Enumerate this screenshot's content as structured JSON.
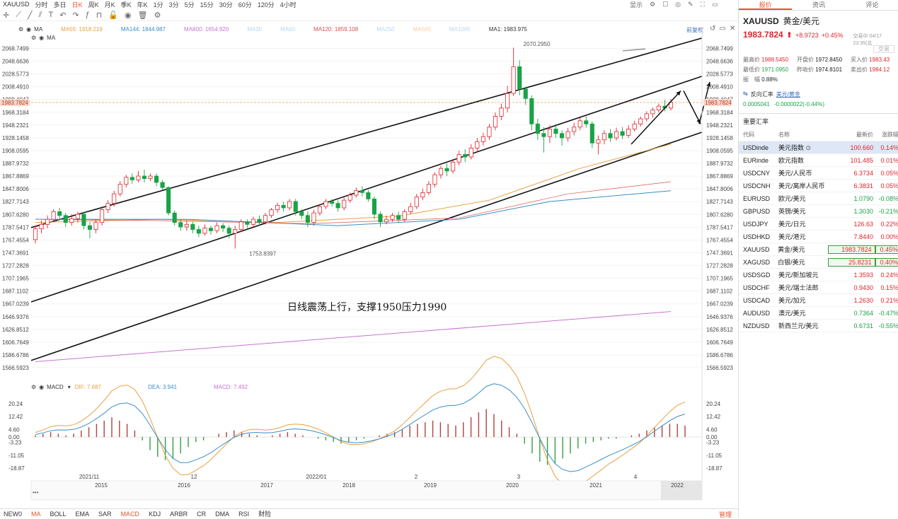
{
  "toolbar": {
    "symbol": "XAUUSD",
    "periods": [
      "分时",
      "多日",
      "日K",
      "周K",
      "月K",
      "季K",
      "年K",
      "1分",
      "3分",
      "5分",
      "15分",
      "30分",
      "60分",
      "120分",
      "4小时"
    ],
    "active_period": "日K",
    "display_label": "显示",
    "icons": [
      "crosshair-icon",
      "draw-icon",
      "line-icon",
      "text-icon",
      "indicator-icon",
      "undo-icon",
      "redo-icon",
      "fx-icon",
      "magnet-icon",
      "lock-icon",
      "eye-icon",
      "delete-icon",
      "settings-icon"
    ]
  },
  "legend": {
    "row1_name": "MA",
    "ma55": "MA55: 1918.219",
    "ma144": "MA144: 1844.987",
    "ma800": "MA800: 1654.920",
    "ma30": "MA30",
    "ma60": "MA60",
    "ma120": "MA120: 1859.108",
    "ma250": "MA250",
    "ma500": "MA500",
    "ma1000": "MA1000",
    "ma1": "MA1: 1983.975",
    "row2_name": "MA",
    "fq_label": "前复权",
    "colors": {
      "ma55": "#e8a040",
      "ma144": "#3a8fc7",
      "ma800": "#c774d0",
      "ma120": "#d9534f",
      "ma1": "#333333",
      "muted": "#b8d8f0"
    }
  },
  "annotation_text": "日线震荡上行，支撑1950压力1990",
  "high_label": "2070.2950",
  "low_label": "1753.8397",
  "current_price_tag": "1983.7824",
  "macd_legend": {
    "name": "MACD",
    "dif": "DIF: 7.687",
    "dea": "DEA: 3.941",
    "macd": "MACD: 7.492"
  },
  "price_axis": [
    "2068.7499",
    "2048.6636",
    "2028.5773",
    "2008.4910",
    "1988.4047",
    "1968.3184",
    "1948.2321",
    "1928.1458",
    "1908.0595",
    "1887.9732",
    "1867.8869",
    "1847.8006",
    "1827.7143",
    "1807.6280",
    "1787.5417",
    "1767.4554",
    "1747.3691",
    "1727.2828",
    "1707.1965",
    "1687.1102",
    "1667.0239",
    "1646.9376",
    "1626.8512",
    "1606.7649",
    "1586.6786",
    "1566.5923"
  ],
  "macd_axis": [
    "20.24",
    "12.42",
    "4.60",
    "0.00",
    "-3.23",
    "-11.05",
    "-18.87"
  ],
  "date_axis_top": [
    "2021/11",
    "12",
    "2022/01",
    "2",
    "3",
    "4"
  ],
  "date_axis_bottom": [
    "2015",
    "2016",
    "2017",
    "2018",
    "2019",
    "2020",
    "2021",
    "2022"
  ],
  "bottom_indicators": [
    "NEW0",
    "MA",
    "BOLL",
    "EMA",
    "SAR",
    "MACD",
    "KDJ",
    "ARBR",
    "CR",
    "DMA",
    "RSI",
    "财险"
  ],
  "bottom_active": [
    "MA",
    "MACD"
  ],
  "bottom_right_label": "管理",
  "panel": {
    "tabs": [
      "报价",
      "资讯",
      "评论"
    ],
    "active_tab": "报价",
    "symbol": "XAUUSD",
    "name": "黄金/美元",
    "price": "1983.7824",
    "change": "+8.9723",
    "change_pct": "+0.45%",
    "time_label": "交易中 04/17 23:35(北",
    "trade_label": "交易",
    "stats": [
      {
        "label": "最高价",
        "value": "1988.5450"
      },
      {
        "label": "开盘价",
        "value": "1972.8450"
      },
      {
        "label": "买入价",
        "value": "1983.43"
      },
      {
        "label": "最低价",
        "value": "1971.0950"
      },
      {
        "label": "昨收价",
        "value": "1974.8101"
      },
      {
        "label": "卖出价",
        "value": "1984.12"
      }
    ],
    "amplitude_label": "振　幅",
    "amplitude_value": "0.88%",
    "reverse_label": "反向汇率",
    "reverse_pair": "美元/黄金",
    "reverse_value": "0.0005041",
    "reverse_change": "-0.0000022(-0.44%)",
    "section_title": "重要汇率",
    "table_headers": [
      "代码",
      "名称",
      "最新价",
      "涨跌幅"
    ],
    "rows": [
      {
        "code": "USDinde",
        "name": "美元指数",
        "price": "100.660",
        "pct": "0.14%",
        "dir": "up",
        "selected": true
      },
      {
        "code": "EURinde",
        "name": "欧元指数",
        "price": "101.485",
        "pct": "0.01%",
        "dir": "up"
      },
      {
        "code": "USDCNY",
        "name": "美元/人民币",
        "price": "6.3734",
        "pct": "0.05%",
        "dir": "up"
      },
      {
        "code": "USDCNH",
        "name": "美元/离岸人民币",
        "price": "6.3831",
        "pct": "0.05%",
        "dir": "up"
      },
      {
        "code": "EURUSD",
        "name": "欧元/美元",
        "price": "1.0790",
        "pct": "-0.08%",
        "dir": "down"
      },
      {
        "code": "GBPUSD",
        "name": "英镑/美元",
        "price": "1.3030",
        "pct": "-0.21%",
        "dir": "down"
      },
      {
        "code": "USDJPY",
        "name": "美元/日元",
        "price": "126.63",
        "pct": "0.22%",
        "dir": "up"
      },
      {
        "code": "USDHKD",
        "name": "美元/港元",
        "price": "7.8440",
        "pct": "0.00%",
        "dir": "up"
      },
      {
        "code": "XAUUSD",
        "name": "黄金/美元",
        "price": "1983.7824",
        "pct": "0.45%",
        "dir": "up",
        "highlight": true
      },
      {
        "code": "XAGUSD",
        "name": "白银/美元",
        "price": "25.8231",
        "pct": "0.40%",
        "dir": "up",
        "highlight": true
      },
      {
        "code": "USDSGD",
        "name": "美元/新加坡元",
        "price": "1.3593",
        "pct": "0.24%",
        "dir": "up"
      },
      {
        "code": "USDCHF",
        "name": "美元/瑞士法郎",
        "price": "0.9430",
        "pct": "0.15%",
        "dir": "up"
      },
      {
        "code": "USDCAD",
        "name": "美元/加元",
        "price": "1.2630",
        "pct": "0.21%",
        "dir": "up"
      },
      {
        "code": "AUDUSD",
        "name": "澳元/美元",
        "price": "0.7364",
        "pct": "-0.47%",
        "dir": "down"
      },
      {
        "code": "NZDUSD",
        "name": "新西兰元/美元",
        "price": "0.6731",
        "pct": "-0.55%",
        "dir": "down"
      }
    ]
  },
  "chart_data": {
    "type": "candlestick",
    "symbol": "XAUUSD",
    "period": "daily",
    "ylim": [
      1566.5923,
      2068.7499
    ],
    "high": 2070.295,
    "low": 1753.8397,
    "last": 1983.7824,
    "candles_approx": [
      {
        "o": 1768,
        "c": 1785,
        "h": 1790,
        "l": 1762
      },
      {
        "o": 1785,
        "c": 1792,
        "h": 1798,
        "l": 1778
      },
      {
        "o": 1792,
        "c": 1800,
        "h": 1806,
        "l": 1786
      },
      {
        "o": 1800,
        "c": 1812,
        "h": 1816,
        "l": 1796
      },
      {
        "o": 1812,
        "c": 1806,
        "h": 1818,
        "l": 1800
      },
      {
        "o": 1806,
        "c": 1795,
        "h": 1810,
        "l": 1788
      },
      {
        "o": 1795,
        "c": 1801,
        "h": 1808,
        "l": 1790
      },
      {
        "o": 1801,
        "c": 1808,
        "h": 1812,
        "l": 1795
      },
      {
        "o": 1808,
        "c": 1790,
        "h": 1812,
        "l": 1784
      },
      {
        "o": 1790,
        "c": 1784,
        "h": 1796,
        "l": 1770
      },
      {
        "o": 1784,
        "c": 1795,
        "h": 1800,
        "l": 1778
      },
      {
        "o": 1795,
        "c": 1815,
        "h": 1820,
        "l": 1790
      },
      {
        "o": 1815,
        "c": 1825,
        "h": 1830,
        "l": 1810
      },
      {
        "o": 1825,
        "c": 1840,
        "h": 1845,
        "l": 1820
      },
      {
        "o": 1840,
        "c": 1855,
        "h": 1860,
        "l": 1836
      },
      {
        "o": 1855,
        "c": 1866,
        "h": 1870,
        "l": 1850
      },
      {
        "o": 1866,
        "c": 1862,
        "h": 1872,
        "l": 1856
      },
      {
        "o": 1862,
        "c": 1868,
        "h": 1876,
        "l": 1858
      },
      {
        "o": 1868,
        "c": 1864,
        "h": 1878,
        "l": 1858
      },
      {
        "o": 1864,
        "c": 1868,
        "h": 1872,
        "l": 1860
      },
      {
        "o": 1868,
        "c": 1858,
        "h": 1872,
        "l": 1852
      },
      {
        "o": 1858,
        "c": 1850,
        "h": 1862,
        "l": 1846
      },
      {
        "o": 1850,
        "c": 1810,
        "h": 1852,
        "l": 1806
      },
      {
        "o": 1810,
        "c": 1795,
        "h": 1814,
        "l": 1790
      },
      {
        "o": 1795,
        "c": 1788,
        "h": 1800,
        "l": 1782
      },
      {
        "o": 1788,
        "c": 1792,
        "h": 1798,
        "l": 1782
      },
      {
        "o": 1792,
        "c": 1784,
        "h": 1796,
        "l": 1778
      },
      {
        "o": 1784,
        "c": 1778,
        "h": 1790,
        "l": 1772
      },
      {
        "o": 1778,
        "c": 1786,
        "h": 1792,
        "l": 1774
      },
      {
        "o": 1786,
        "c": 1782,
        "h": 1790,
        "l": 1776
      },
      {
        "o": 1782,
        "c": 1790,
        "h": 1795,
        "l": 1778
      },
      {
        "o": 1790,
        "c": 1786,
        "h": 1794,
        "l": 1780
      },
      {
        "o": 1786,
        "c": 1778,
        "h": 1790,
        "l": 1770
      },
      {
        "o": 1778,
        "c": 1784,
        "h": 1790,
        "l": 1754
      },
      {
        "o": 1784,
        "c": 1796,
        "h": 1800,
        "l": 1780
      },
      {
        "o": 1796,
        "c": 1792,
        "h": 1800,
        "l": 1786
      },
      {
        "o": 1792,
        "c": 1800,
        "h": 1804,
        "l": 1788
      },
      {
        "o": 1800,
        "c": 1796,
        "h": 1806,
        "l": 1790
      },
      {
        "o": 1796,
        "c": 1806,
        "h": 1810,
        "l": 1792
      },
      {
        "o": 1806,
        "c": 1815,
        "h": 1818,
        "l": 1802
      },
      {
        "o": 1815,
        "c": 1822,
        "h": 1826,
        "l": 1810
      },
      {
        "o": 1822,
        "c": 1818,
        "h": 1828,
        "l": 1812
      },
      {
        "o": 1818,
        "c": 1828,
        "h": 1832,
        "l": 1814
      },
      {
        "o": 1828,
        "c": 1812,
        "h": 1832,
        "l": 1806
      },
      {
        "o": 1812,
        "c": 1806,
        "h": 1816,
        "l": 1800
      },
      {
        "o": 1806,
        "c": 1795,
        "h": 1812,
        "l": 1788
      },
      {
        "o": 1795,
        "c": 1810,
        "h": 1815,
        "l": 1790
      },
      {
        "o": 1810,
        "c": 1820,
        "h": 1824,
        "l": 1806
      },
      {
        "o": 1820,
        "c": 1828,
        "h": 1832,
        "l": 1816
      },
      {
        "o": 1828,
        "c": 1825,
        "h": 1832,
        "l": 1820
      },
      {
        "o": 1825,
        "c": 1818,
        "h": 1830,
        "l": 1812
      },
      {
        "o": 1818,
        "c": 1830,
        "h": 1834,
        "l": 1814
      },
      {
        "o": 1830,
        "c": 1838,
        "h": 1842,
        "l": 1826
      },
      {
        "o": 1838,
        "c": 1845,
        "h": 1850,
        "l": 1834
      },
      {
        "o": 1845,
        "c": 1842,
        "h": 1852,
        "l": 1836
      },
      {
        "o": 1842,
        "c": 1832,
        "h": 1846,
        "l": 1828
      },
      {
        "o": 1832,
        "c": 1808,
        "h": 1836,
        "l": 1800
      },
      {
        "o": 1808,
        "c": 1796,
        "h": 1812,
        "l": 1788
      },
      {
        "o": 1796,
        "c": 1800,
        "h": 1806,
        "l": 1792
      },
      {
        "o": 1800,
        "c": 1806,
        "h": 1810,
        "l": 1796
      },
      {
        "o": 1806,
        "c": 1800,
        "h": 1812,
        "l": 1794
      },
      {
        "o": 1800,
        "c": 1812,
        "h": 1816,
        "l": 1796
      },
      {
        "o": 1812,
        "c": 1820,
        "h": 1826,
        "l": 1808
      },
      {
        "o": 1820,
        "c": 1835,
        "h": 1840,
        "l": 1816
      },
      {
        "o": 1835,
        "c": 1842,
        "h": 1848,
        "l": 1830
      },
      {
        "o": 1842,
        "c": 1855,
        "h": 1860,
        "l": 1838
      },
      {
        "o": 1855,
        "c": 1870,
        "h": 1874,
        "l": 1850
      },
      {
        "o": 1870,
        "c": 1880,
        "h": 1884,
        "l": 1864
      },
      {
        "o": 1880,
        "c": 1876,
        "h": 1888,
        "l": 1868
      },
      {
        "o": 1876,
        "c": 1890,
        "h": 1895,
        "l": 1872
      },
      {
        "o": 1890,
        "c": 1902,
        "h": 1908,
        "l": 1885
      },
      {
        "o": 1902,
        "c": 1898,
        "h": 1910,
        "l": 1890
      },
      {
        "o": 1898,
        "c": 1912,
        "h": 1918,
        "l": 1894
      },
      {
        "o": 1912,
        "c": 1922,
        "h": 1928,
        "l": 1906
      },
      {
        "o": 1922,
        "c": 1930,
        "h": 1936,
        "l": 1916
      },
      {
        "o": 1930,
        "c": 1945,
        "h": 1950,
        "l": 1925
      },
      {
        "o": 1945,
        "c": 1962,
        "h": 1968,
        "l": 1940
      },
      {
        "o": 1962,
        "c": 1975,
        "h": 1982,
        "l": 1956
      },
      {
        "o": 1975,
        "c": 1998,
        "h": 2010,
        "l": 1968
      },
      {
        "o": 1998,
        "c": 2040,
        "h": 2070,
        "l": 1994
      },
      {
        "o": 2040,
        "c": 2005,
        "h": 2050,
        "l": 1995
      },
      {
        "o": 2005,
        "c": 1990,
        "h": 2008,
        "l": 1980
      },
      {
        "o": 1990,
        "c": 1950,
        "h": 1995,
        "l": 1940
      },
      {
        "o": 1950,
        "c": 1935,
        "h": 1958,
        "l": 1925
      },
      {
        "o": 1935,
        "c": 1930,
        "h": 1945,
        "l": 1905
      },
      {
        "o": 1930,
        "c": 1942,
        "h": 1948,
        "l": 1920
      },
      {
        "o": 1942,
        "c": 1935,
        "h": 1950,
        "l": 1928
      },
      {
        "o": 1935,
        "c": 1928,
        "h": 1940,
        "l": 1916
      },
      {
        "o": 1928,
        "c": 1938,
        "h": 1944,
        "l": 1922
      },
      {
        "o": 1938,
        "c": 1945,
        "h": 1952,
        "l": 1932
      },
      {
        "o": 1945,
        "c": 1955,
        "h": 1960,
        "l": 1940
      },
      {
        "o": 1955,
        "c": 1950,
        "h": 1962,
        "l": 1944
      },
      {
        "o": 1950,
        "c": 1920,
        "h": 1954,
        "l": 1912
      },
      {
        "o": 1920,
        "c": 1925,
        "h": 1932,
        "l": 1902
      },
      {
        "o": 1925,
        "c": 1935,
        "h": 1940,
        "l": 1918
      },
      {
        "o": 1935,
        "c": 1928,
        "h": 1942,
        "l": 1922
      },
      {
        "o": 1928,
        "c": 1938,
        "h": 1944,
        "l": 1924
      },
      {
        "o": 1938,
        "c": 1932,
        "h": 1945,
        "l": 1926
      },
      {
        "o": 1932,
        "c": 1942,
        "h": 1948,
        "l": 1928
      },
      {
        "o": 1942,
        "c": 1950,
        "h": 1955,
        "l": 1938
      },
      {
        "o": 1950,
        "c": 1958,
        "h": 1962,
        "l": 1946
      },
      {
        "o": 1958,
        "c": 1966,
        "h": 1970,
        "l": 1954
      },
      {
        "o": 1966,
        "c": 1972,
        "h": 1976,
        "l": 1960
      },
      {
        "o": 1972,
        "c": 1978,
        "h": 1982,
        "l": 1968
      },
      {
        "o": 1978,
        "c": 1975,
        "h": 1988,
        "l": 1970
      },
      {
        "o": 1975,
        "c": 1984,
        "h": 1989,
        "l": 1971
      }
    ],
    "channel_lines": [
      {
        "name": "upper-channel",
        "from": {
          "price": 1787
        },
        "to": {
          "price": 2085
        }
      },
      {
        "name": "middle-channel",
        "from": {
          "price": 1670
        },
        "to": {
          "price": 2025
        }
      },
      {
        "name": "lower-channel",
        "from": {
          "price": 1578
        },
        "to": {
          "price": 1937
        }
      }
    ],
    "moving_averages": [
      {
        "name": "MA55",
        "value": 1918.219
      },
      {
        "name": "MA144",
        "value": 1844.987
      },
      {
        "name": "MA800",
        "value": 1654.92
      },
      {
        "name": "MA120",
        "value": 1859.108
      },
      {
        "name": "MA1",
        "value": 1983.975
      }
    ],
    "macd": {
      "dif": 7.687,
      "dea": 3.941,
      "macd": 7.492,
      "ylim": [
        -18.87,
        20.24
      ],
      "hist_approx": [
        1,
        2,
        3,
        2,
        1,
        2,
        4,
        6,
        8,
        10,
        12,
        10,
        8,
        4,
        -2,
        -8,
        -12,
        -14,
        -13,
        -10,
        -6,
        -3,
        -2,
        0,
        2,
        3,
        4,
        3,
        2,
        1,
        0,
        1,
        2,
        3,
        2,
        1,
        0,
        -1,
        -2,
        -3,
        -4,
        -3,
        -2,
        -1,
        0,
        1,
        2,
        3,
        5,
        7,
        8,
        9,
        10,
        9,
        8,
        7,
        9,
        12,
        15,
        17,
        14,
        10,
        6,
        2,
        -4,
        -10,
        -15,
        -17,
        -16,
        -13,
        -10,
        -7,
        -4,
        -3,
        -2,
        -1,
        -1,
        0,
        1,
        2,
        4,
        6,
        7,
        8,
        8,
        7
      ]
    }
  }
}
